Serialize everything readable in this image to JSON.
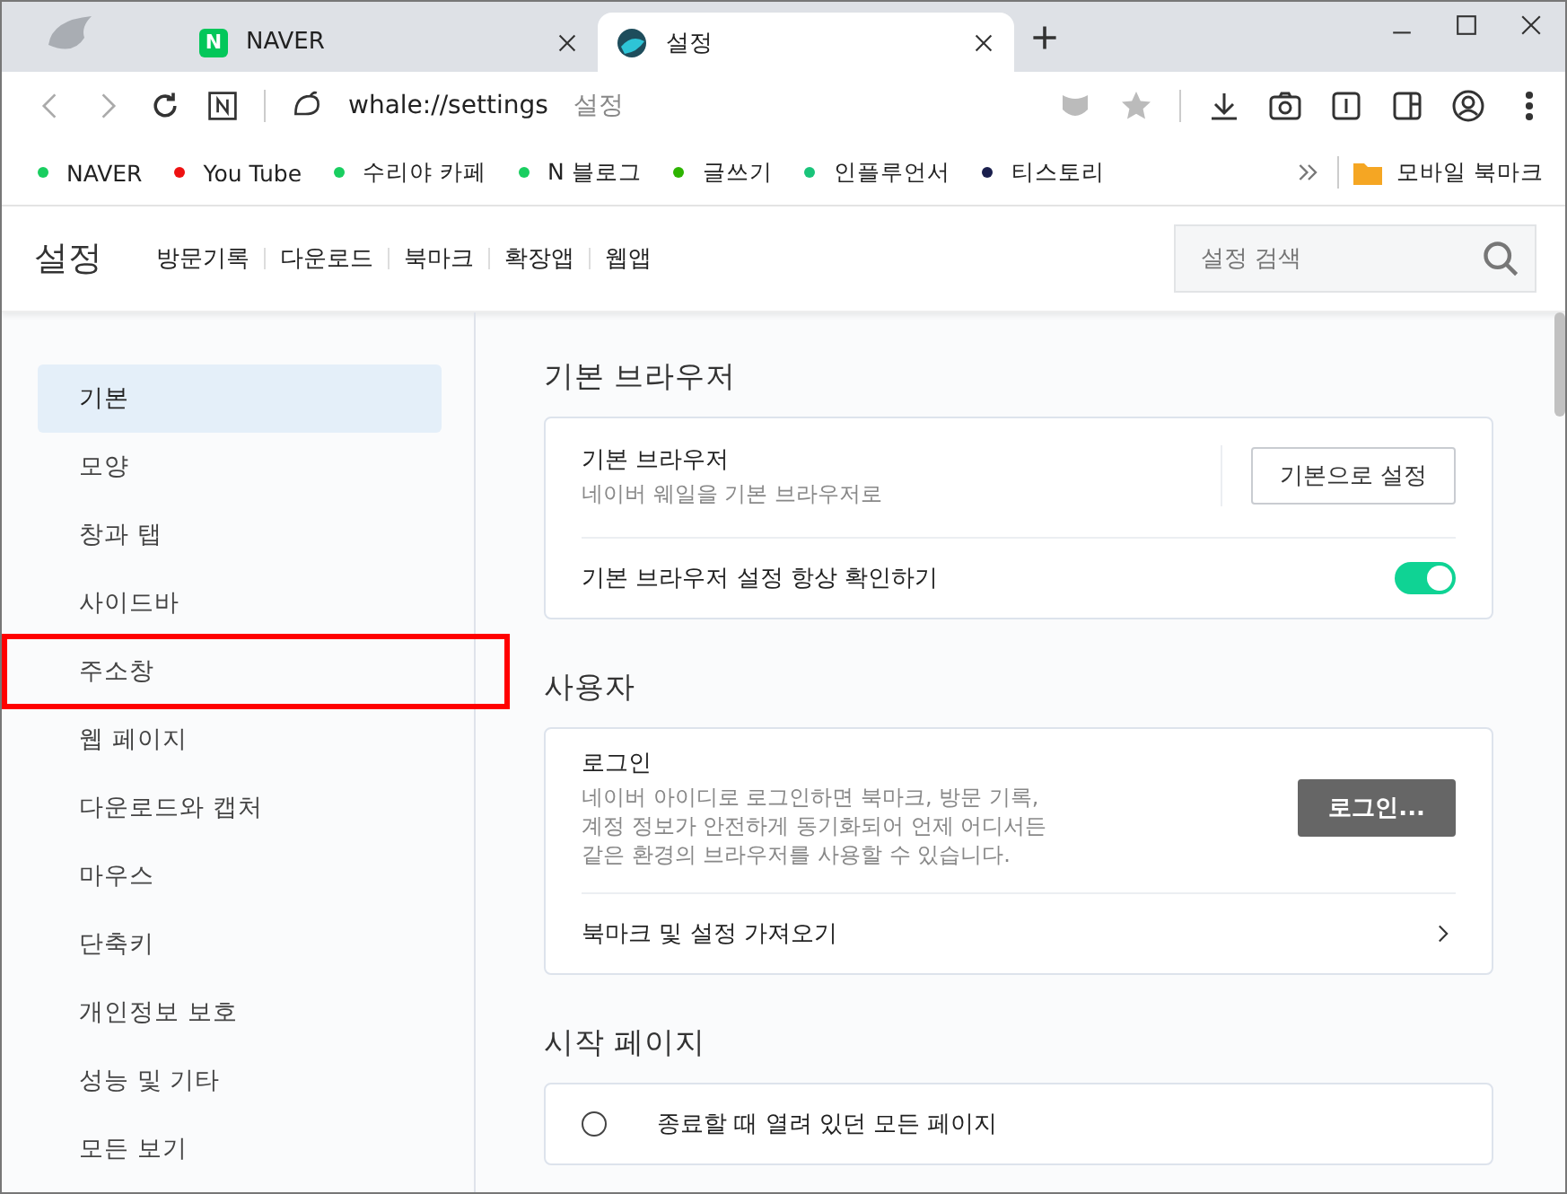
{
  "tabs": [
    {
      "title": "NAVER",
      "selected": false,
      "kind": "naver",
      "favicon_letter": "N"
    },
    {
      "title": "설정",
      "selected": true,
      "kind": "whale"
    }
  ],
  "address_bar": {
    "url": "whale://settings",
    "page_title": "설정"
  },
  "bookmarks": [
    {
      "label": "NAVER",
      "color": "#19ce60"
    },
    {
      "label": "You Tube",
      "color": "#ee1111"
    },
    {
      "label": "수리야 카페",
      "color": "#19ce60"
    },
    {
      "label": "N 블로그",
      "color": "#19ce60"
    },
    {
      "label": "글쓰기",
      "color": "#2db400"
    },
    {
      "label": "인플루언서",
      "color": "#19c47a"
    },
    {
      "label": "티스토리",
      "color": "#1a1f4d"
    }
  ],
  "bookmarks_folder": {
    "label": "모바일 북마크"
  },
  "header": {
    "title": "설정",
    "links": [
      "방문기록",
      "다운로드",
      "북마크",
      "확장앱",
      "웹앱"
    ],
    "search": {
      "placeholder": "설정 검색"
    }
  },
  "sidebar": {
    "items": [
      {
        "label": "기본",
        "selected": true,
        "highlighted": false
      },
      {
        "label": "모양",
        "selected": false,
        "highlighted": false
      },
      {
        "label": "창과 탭",
        "selected": false,
        "highlighted": false
      },
      {
        "label": "사이드바",
        "selected": false,
        "highlighted": false
      },
      {
        "label": "주소창",
        "selected": false,
        "highlighted": true
      },
      {
        "label": "웹 페이지",
        "selected": false,
        "highlighted": false
      },
      {
        "label": "다운로드와 캡처",
        "selected": false,
        "highlighted": false
      },
      {
        "label": "마우스",
        "selected": false,
        "highlighted": false
      },
      {
        "label": "단축키",
        "selected": false,
        "highlighted": false
      },
      {
        "label": "개인정보 보호",
        "selected": false,
        "highlighted": false
      },
      {
        "label": "성능 및 기타",
        "selected": false,
        "highlighted": false
      },
      {
        "label": "모든 보기",
        "selected": false,
        "highlighted": false
      }
    ]
  },
  "sections": [
    {
      "title": "기본 브라우저",
      "rows": [
        {
          "kind": "button",
          "title": "기본 브라우저",
          "description": "네이버 웨일을 기본 브라우저로",
          "button": "기본으로 설정",
          "primary": false
        },
        {
          "kind": "toggle",
          "title": "기본 브라우저 설정 항상 확인하기",
          "on": true
        }
      ]
    },
    {
      "title": "사용자",
      "rows": [
        {
          "kind": "button",
          "title": "로그인",
          "description": "네이버 아이디로 로그인하면 북마크, 방문 기록,\n계정 정보가 안전하게 동기화되어 언제 어디서든\n같은 환경의 브라우저를 사용할 수 있습니다.",
          "button": "로그인...",
          "primary": true
        },
        {
          "kind": "link",
          "title": "북마크 및 설정 가져오기"
        }
      ]
    },
    {
      "title": "시작 페이지",
      "rows": [
        {
          "kind": "radio",
          "title": "종료할 때 열려 있던 모든 페이지",
          "selected": false
        }
      ]
    }
  ]
}
